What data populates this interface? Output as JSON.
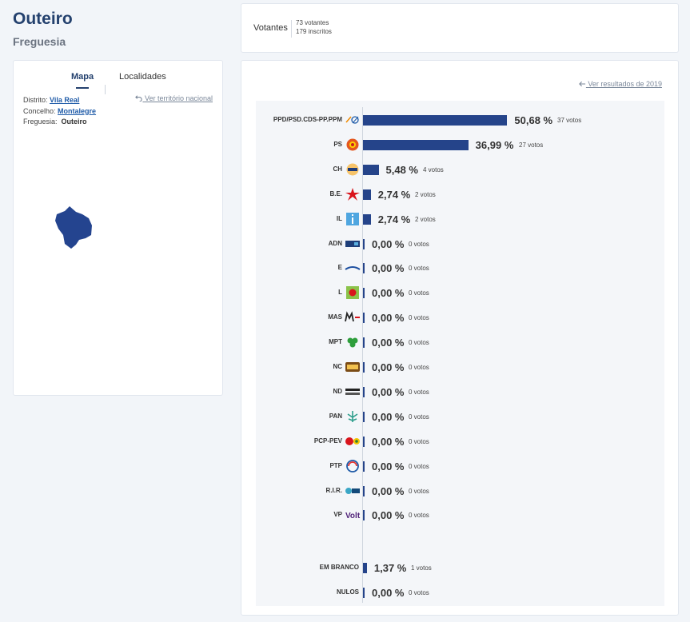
{
  "page": {
    "title": "Outeiro",
    "subtitle": "Freguesia"
  },
  "map_panel": {
    "tabs": [
      {
        "label": "Mapa",
        "active": true
      },
      {
        "label": "Localidades",
        "active": false
      }
    ],
    "distrito_label": "Distrito:",
    "distrito_value": "Vila Real",
    "concelho_label": "Concelho:",
    "concelho_value": "Montalegre",
    "freguesia_label": "Freguesia:",
    "freguesia_value": "Outeiro",
    "ver_nacional": "Ver território nacional",
    "map_color": "#24448f"
  },
  "votantes": {
    "label": "Votantes",
    "votantes_text": "73 votantes",
    "inscritos_text": "179 inscritos"
  },
  "results": {
    "ver_2019": "Ver resultados de 2019",
    "bar_color": "#25448a",
    "parties": [
      {
        "name": "PPD/PSD.CDS-PP.PPM",
        "pct": 50.68,
        "pct_text": "50,68 %",
        "votes_text": "37 votos",
        "logo": "ppd-psd-cds-ppm-logo"
      },
      {
        "name": "PS",
        "pct": 36.99,
        "pct_text": "36,99 %",
        "votes_text": "27 votos",
        "logo": "ps-logo"
      },
      {
        "name": "CH",
        "pct": 5.48,
        "pct_text": "5,48 %",
        "votes_text": "4 votos",
        "logo": "ch-logo"
      },
      {
        "name": "B.E.",
        "pct": 2.74,
        "pct_text": "2,74 %",
        "votes_text": "2 votos",
        "logo": "be-logo"
      },
      {
        "name": "IL",
        "pct": 2.74,
        "pct_text": "2,74 %",
        "votes_text": "2 votos",
        "logo": "il-logo"
      },
      {
        "name": "ADN",
        "pct": 0,
        "pct_text": "0,00 %",
        "votes_text": "0 votos",
        "logo": "adn-logo"
      },
      {
        "name": "E",
        "pct": 0,
        "pct_text": "0,00 %",
        "votes_text": "0 votos",
        "logo": "e-logo"
      },
      {
        "name": "L",
        "pct": 0,
        "pct_text": "0,00 %",
        "votes_text": "0 votos",
        "logo": "l-logo"
      },
      {
        "name": "MAS",
        "pct": 0,
        "pct_text": "0,00 %",
        "votes_text": "0 votos",
        "logo": "mas-logo"
      },
      {
        "name": "MPT",
        "pct": 0,
        "pct_text": "0,00 %",
        "votes_text": "0 votos",
        "logo": "mpt-logo"
      },
      {
        "name": "NC",
        "pct": 0,
        "pct_text": "0,00 %",
        "votes_text": "0 votos",
        "logo": "nc-logo"
      },
      {
        "name": "ND",
        "pct": 0,
        "pct_text": "0,00 %",
        "votes_text": "0 votos",
        "logo": "nd-logo"
      },
      {
        "name": "PAN",
        "pct": 0,
        "pct_text": "0,00 %",
        "votes_text": "0 votos",
        "logo": "pan-logo"
      },
      {
        "name": "PCP-PEV",
        "pct": 0,
        "pct_text": "0,00 %",
        "votes_text": "0 votos",
        "logo": "pcp-pev-logo"
      },
      {
        "name": "PTP",
        "pct": 0,
        "pct_text": "0,00 %",
        "votes_text": "0 votos",
        "logo": "ptp-logo"
      },
      {
        "name": "R.I.R.",
        "pct": 0,
        "pct_text": "0,00 %",
        "votes_text": "0 votos",
        "logo": "rir-logo"
      },
      {
        "name": "VP",
        "pct": 0,
        "pct_text": "0,00 %",
        "votes_text": "0 votos",
        "logo": "vp-logo"
      }
    ],
    "others": [
      {
        "name": "EM BRANCO",
        "pct": 1.37,
        "pct_text": "1,37 %",
        "votes_text": "1 votos"
      },
      {
        "name": "NULOS",
        "pct": 0,
        "pct_text": "0,00 %",
        "votes_text": "0 votos"
      }
    ]
  }
}
